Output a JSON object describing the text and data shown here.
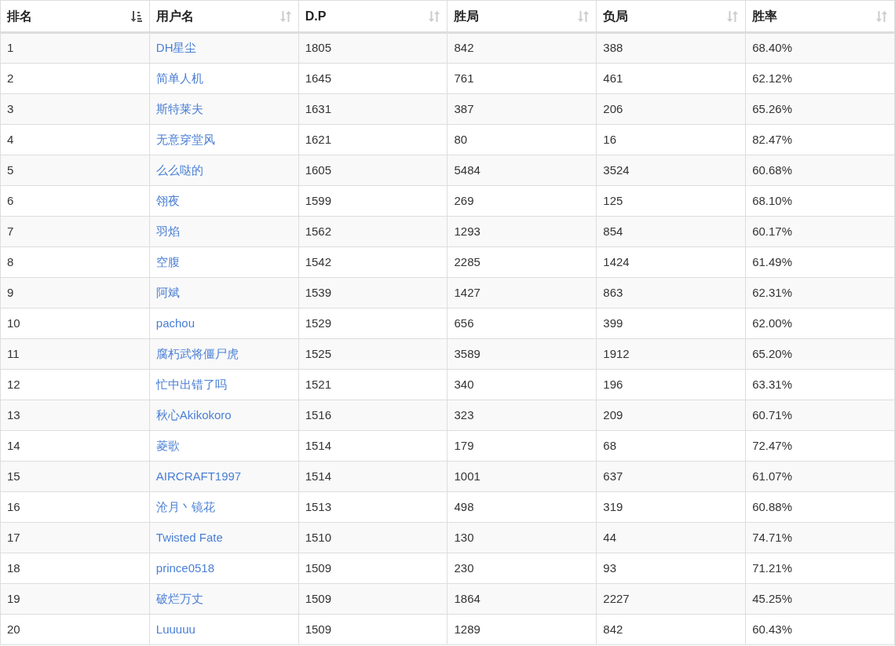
{
  "table": {
    "columns": [
      {
        "label": "排名",
        "kind": "text",
        "sorted": true
      },
      {
        "label": "用户名",
        "kind": "link",
        "sorted": false
      },
      {
        "label": "D.P",
        "kind": "text",
        "sorted": false
      },
      {
        "label": "胜局",
        "kind": "text",
        "sorted": false
      },
      {
        "label": "负局",
        "kind": "text",
        "sorted": false
      },
      {
        "label": "胜率",
        "kind": "text",
        "sorted": false
      }
    ],
    "rows": [
      [
        "1",
        "DH星尘",
        "1805",
        "842",
        "388",
        "68.40%"
      ],
      [
        "2",
        "简单人机",
        "1645",
        "761",
        "461",
        "62.12%"
      ],
      [
        "3",
        "斯特莱夫",
        "1631",
        "387",
        "206",
        "65.26%"
      ],
      [
        "4",
        "无意穿堂风",
        "1621",
        "80",
        "16",
        "82.47%"
      ],
      [
        "5",
        "么么哒的",
        "1605",
        "5484",
        "3524",
        "60.68%"
      ],
      [
        "6",
        "翎夜",
        "1599",
        "269",
        "125",
        "68.10%"
      ],
      [
        "7",
        "羽焰",
        "1562",
        "1293",
        "854",
        "60.17%"
      ],
      [
        "8",
        "空腹",
        "1542",
        "2285",
        "1424",
        "61.49%"
      ],
      [
        "9",
        "阿斌",
        "1539",
        "1427",
        "863",
        "62.31%"
      ],
      [
        "10",
        "pachou",
        "1529",
        "656",
        "399",
        "62.00%"
      ],
      [
        "11",
        "腐朽武将僵尸虎",
        "1525",
        "3589",
        "1912",
        "65.20%"
      ],
      [
        "12",
        "忙中出错了吗",
        "1521",
        "340",
        "196",
        "63.31%"
      ],
      [
        "13",
        "秋心Akikokoro",
        "1516",
        "323",
        "209",
        "60.71%"
      ],
      [
        "14",
        "菱歌",
        "1514",
        "179",
        "68",
        "72.47%"
      ],
      [
        "15",
        "AIRCRAFT1997",
        "1514",
        "1001",
        "637",
        "61.07%"
      ],
      [
        "16",
        "沧月丶镜花",
        "1513",
        "498",
        "319",
        "60.88%"
      ],
      [
        "17",
        "Twisted Fate",
        "1510",
        "130",
        "44",
        "74.71%"
      ],
      [
        "18",
        "prince0518",
        "1509",
        "230",
        "93",
        "71.21%"
      ],
      [
        "19",
        "破烂万丈",
        "1509",
        "1864",
        "2227",
        "45.25%"
      ],
      [
        "20",
        "Luuuuu",
        "1509",
        "1289",
        "842",
        "60.43%"
      ]
    ]
  }
}
